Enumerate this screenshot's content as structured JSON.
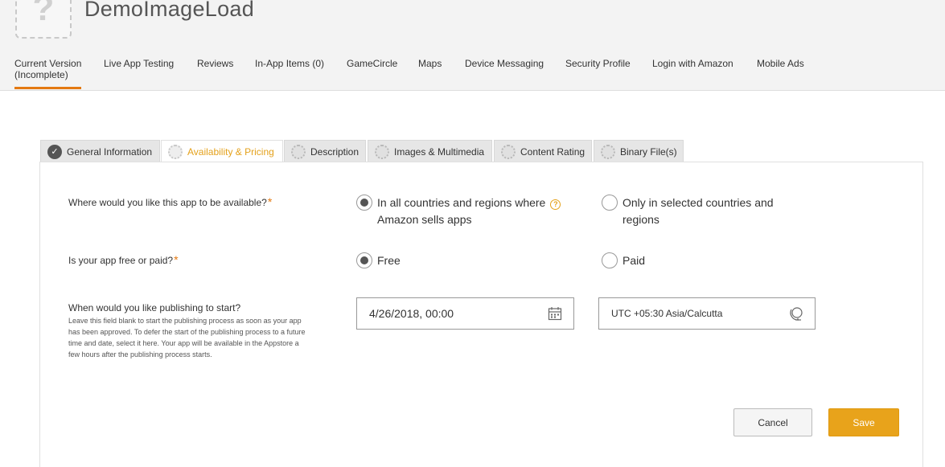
{
  "app": {
    "title": "DemoImageLoad",
    "icon_glyph": "?"
  },
  "nav": {
    "items": [
      {
        "label": "Current Version",
        "sub": "(Incomplete)"
      },
      {
        "label": "Live App Testing"
      },
      {
        "label": "Reviews"
      },
      {
        "label": "In-App Items (0)"
      },
      {
        "label": "GameCircle"
      },
      {
        "label": "Maps"
      },
      {
        "label": "Device Messaging"
      },
      {
        "label": "Security Profile"
      },
      {
        "label": "Login with Amazon"
      },
      {
        "label": "Mobile Ads"
      }
    ],
    "active_index": 0,
    "accent_color": "#e47911"
  },
  "tabs": [
    {
      "label": "General Information",
      "status": "complete"
    },
    {
      "label": "Availability & Pricing",
      "status": "pending"
    },
    {
      "label": "Description",
      "status": "pending"
    },
    {
      "label": "Images & Multimedia",
      "status": "pending"
    },
    {
      "label": "Content Rating",
      "status": "pending"
    },
    {
      "label": "Binary File(s)",
      "status": "pending"
    }
  ],
  "form": {
    "availability": {
      "question": "Where would you like this app to be available?",
      "required_mark": "*",
      "option_all_line1": "In all countries and regions where",
      "option_all_line2": "Amazon sells apps",
      "option_selected_line1": "Only in selected countries and",
      "option_selected_line2": "regions",
      "help_icon": "?",
      "selected": "all"
    },
    "pricing": {
      "question": "Is your app free or paid?",
      "required_mark": "*",
      "option_free": "Free",
      "option_paid": "Paid",
      "selected": "free"
    },
    "publishing": {
      "question": "When would you like publishing to start?",
      "help": "Leave this field blank to start the publishing process as soon as your app has been approved. To defer the start of the publishing process to a future time and date, select it here. Your app will be available in the Appstore a few hours after the publishing process starts.",
      "date_value": "4/26/2018, 00:00",
      "timezone_value": "UTC +05:30 Asia/Calcutta"
    }
  },
  "buttons": {
    "cancel": "Cancel",
    "save": "Save",
    "save_color": "#e8a31b"
  }
}
